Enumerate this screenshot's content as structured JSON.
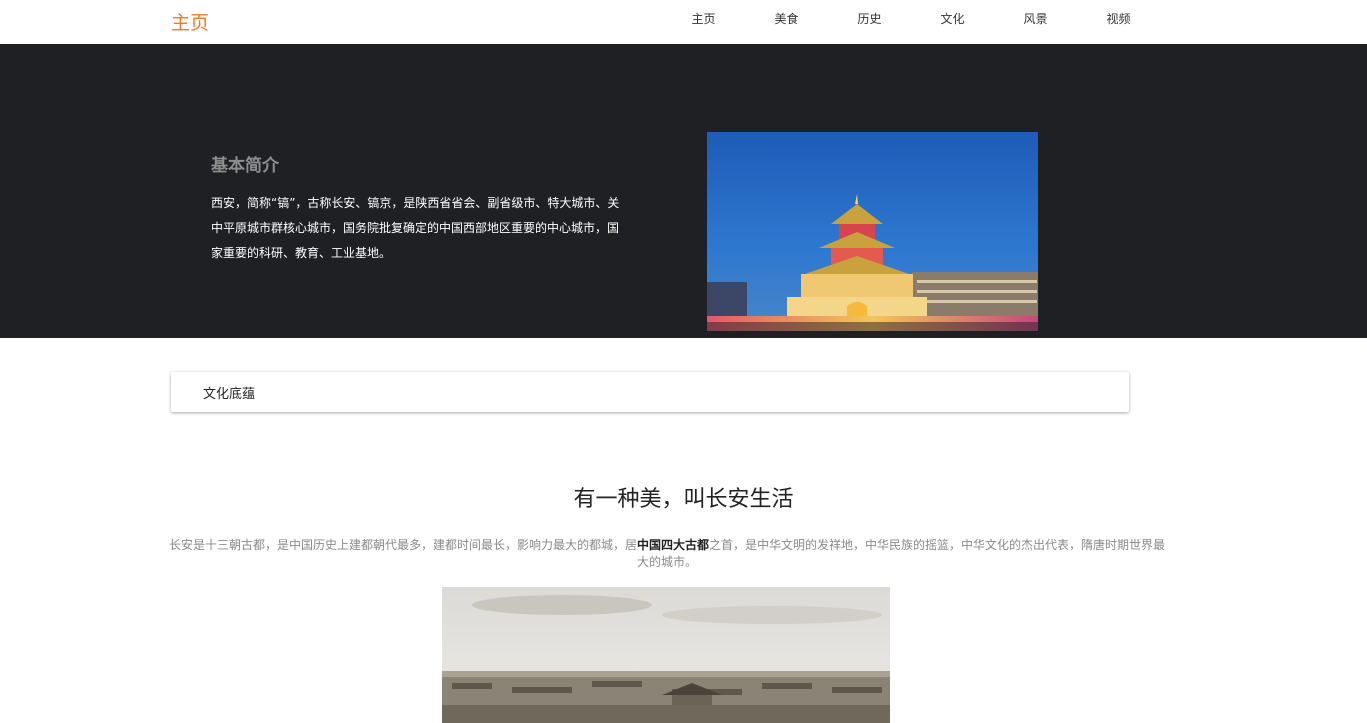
{
  "navbar": {
    "brand": "主页",
    "links": [
      {
        "label": "主页"
      },
      {
        "label": "美食"
      },
      {
        "label": "历史"
      },
      {
        "label": "文化"
      },
      {
        "label": "风景"
      },
      {
        "label": "视频"
      }
    ]
  },
  "hero": {
    "title": "基本简介",
    "text": "西安，简称“镐”，古称长安、镐京，是陕西省省会、副省级市、特大城市、关中平原城市群核心城市，国务院批复确定的中国西部地区重要的中心城市，国家重要的科研、教育、工业基地。",
    "image_label": "bell-tower-night-photo"
  },
  "section_card": {
    "title": "文化底蕴"
  },
  "culture": {
    "headline": "有一种美，叫长安生活",
    "desc_before": "长安是十三朝古都，是中国历史上建都朝代最多，建都时间最长，影响力最大的都城，居",
    "desc_strong": "中国四大古都",
    "desc_after": "之首，是中华文明的发祥地，中华民族的摇篮，中华文化的杰出代表，隋唐时期世界最大的城市。",
    "image_label": "ancient-city-panorama-photo"
  },
  "colors": {
    "brand": "#f07a2a",
    "hero_bg": "#1e2024"
  }
}
